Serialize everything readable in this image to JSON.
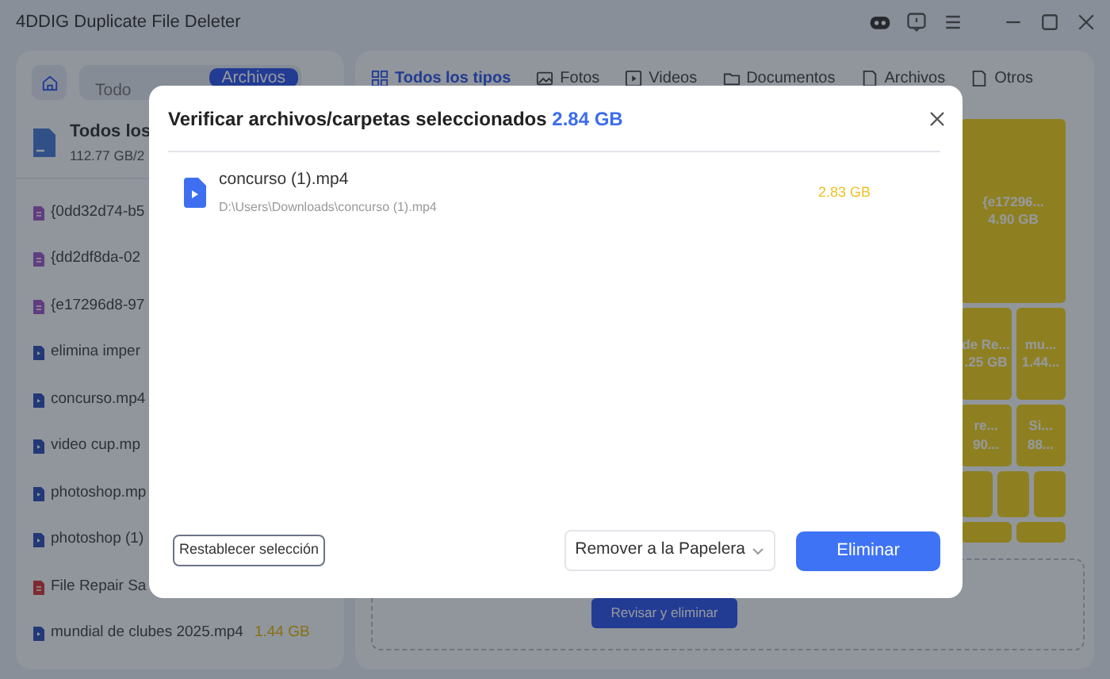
{
  "window": {
    "title": "4DDIG Duplicate File Deleter"
  },
  "sidebar": {
    "toggle": [
      {
        "label": "Todo",
        "selected": false
      },
      {
        "label": "Archivos",
        "selected": true
      }
    ],
    "summary": {
      "title": "Todos los",
      "usage": "112.77 GB/2"
    },
    "items": [
      {
        "kind": "doc",
        "name": "{0dd32d74-b5"
      },
      {
        "kind": "doc",
        "name": "{dd2df8da-02"
      },
      {
        "kind": "doc",
        "name": "{e17296d8-97"
      },
      {
        "kind": "video",
        "name": "elimina imper"
      },
      {
        "kind": "video",
        "name": "concurso.mp4"
      },
      {
        "kind": "video",
        "name": "video cup.mp"
      },
      {
        "kind": "video",
        "name": "photoshop.mp"
      },
      {
        "kind": "video",
        "name": "photoshop (1)"
      },
      {
        "kind": "pdf",
        "name": "File Repair Sa"
      },
      {
        "kind": "video",
        "name": "mundial de clubes 2025.mp4",
        "size": "1.44 GB"
      }
    ]
  },
  "tabs": [
    {
      "label": "Todos los tipos",
      "selected": true
    },
    {
      "label": "Fotos",
      "selected": false
    },
    {
      "label": "Videos",
      "selected": false
    },
    {
      "label": "Documentos",
      "selected": false
    },
    {
      "label": "Archivos",
      "selected": false
    },
    {
      "label": "Otros",
      "selected": false
    }
  ],
  "treemap": [
    [
      {
        "kind": "labelled",
        "label": "{e17296...",
        "size": "4.90 GB"
      }
    ],
    [
      {
        "kind": "labelled",
        "label": "de Re...",
        "size": ".25 GB"
      },
      {
        "kind": "labelled",
        "label": "mu...",
        "size": "1.44..."
      }
    ],
    [
      {
        "kind": "labelled",
        "label": "re...",
        "size": "90..."
      },
      {
        "kind": "labelled",
        "label": "Si...",
        "size": "88..."
      }
    ],
    [
      {
        "kind": "blank"
      },
      {
        "kind": "blank"
      },
      {
        "kind": "blank"
      }
    ],
    [
      {
        "kind": "blank"
      },
      {
        "kind": "blank"
      }
    ]
  ],
  "review_button": "Revisar y eliminar",
  "dialog": {
    "title": "Verificar archivos/carpetas seleccionados",
    "total": "2.84 GB",
    "files": [
      {
        "name": "concurso (1).mp4",
        "path": "D:\\Users\\Downloads\\concurso (1).mp4",
        "size": "2.83 GB"
      }
    ],
    "reset_button": "Restablecer selección",
    "mode_dropdown": "Remover a la Papelera",
    "delete_button": "Eliminar"
  }
}
